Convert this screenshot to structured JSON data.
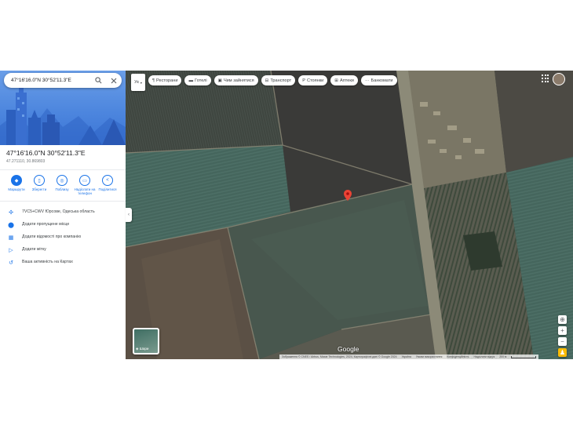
{
  "search": {
    "value": "47°16'16.0\"N 30°52'11.3\"E"
  },
  "place": {
    "title": "47°16'16.0\"N 30°52'11.3\"E",
    "coords": "47.271110, 30.869803"
  },
  "actions": [
    {
      "label": "Маршрути",
      "icon": "directions-icon"
    },
    {
      "label": "Зберегти",
      "icon": "bookmark-icon"
    },
    {
      "label": "Поблизу",
      "icon": "nearby-icon"
    },
    {
      "label": "Надіслати на телефон",
      "icon": "phone-icon"
    },
    {
      "label": "Поділитися",
      "icon": "share-icon"
    }
  ],
  "info_rows": [
    {
      "text": "7VC5+CWV Юрсове, Одеська область",
      "icon": "plus-code-icon"
    },
    {
      "text": "Додати пропущене місце",
      "icon": "add-place-icon"
    },
    {
      "text": "Додати відомості про компанію",
      "icon": "business-icon"
    },
    {
      "text": "Додати мітку",
      "icon": "label-icon"
    },
    {
      "text": "Ваша активність на Картах",
      "icon": "history-icon"
    }
  ],
  "language_button": "Ук",
  "chips": [
    {
      "label": "Ресторани",
      "icon": "restaurant-icon"
    },
    {
      "label": "Готелі",
      "icon": "hotel-icon"
    },
    {
      "label": "Чим зайнятися",
      "icon": "camera-icon"
    },
    {
      "label": "Транспорт",
      "icon": "transit-icon"
    },
    {
      "label": "Стоянки",
      "icon": "parking-icon"
    },
    {
      "label": "Аптеки",
      "icon": "pharmacy-icon"
    },
    {
      "label": "Банкомати",
      "icon": "atm-icon"
    }
  ],
  "layers_label": "Шари",
  "google_logo": "Google",
  "attribution": {
    "text": "Зображення © CNES / Airbus, Maxar Technologies, 2024, Картографічні дані © Google 2024",
    "links": [
      "Україна",
      "Умови використання",
      "Конфіденційність",
      "Надіслати відгук"
    ],
    "scale": "200 м"
  },
  "colors": {
    "accent": "#1a73e8",
    "pin": "#ea4335"
  }
}
